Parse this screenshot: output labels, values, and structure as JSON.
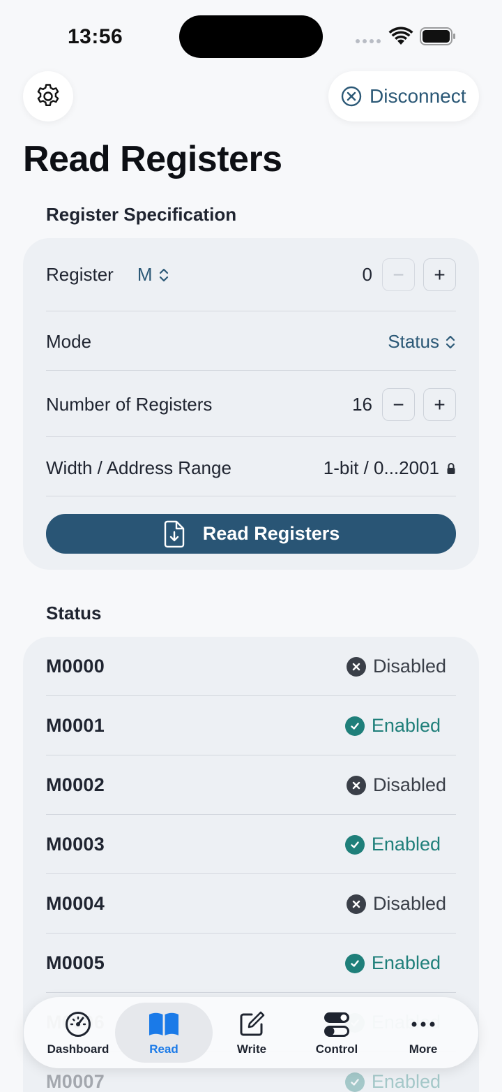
{
  "status_bar": {
    "time": "13:56"
  },
  "header": {
    "disconnect_label": "Disconnect",
    "title": "Read Registers"
  },
  "spec": {
    "section_title": "Register Specification",
    "register_label": "Register",
    "register_type": "M",
    "register_start": "0",
    "mode_label": "Mode",
    "mode_value": "Status",
    "count_label": "Number of Registers",
    "count_value": "16",
    "range_label": "Width / Address Range",
    "range_value": "1-bit / 0...2001",
    "read_button": "Read Registers",
    "minus": "−",
    "plus": "+"
  },
  "status": {
    "section_title": "Status",
    "rows": [
      {
        "name": "M0000",
        "state": "Disabled",
        "enabled": false
      },
      {
        "name": "M0001",
        "state": "Enabled",
        "enabled": true
      },
      {
        "name": "M0002",
        "state": "Disabled",
        "enabled": false
      },
      {
        "name": "M0003",
        "state": "Enabled",
        "enabled": true
      },
      {
        "name": "M0004",
        "state": "Disabled",
        "enabled": false
      },
      {
        "name": "M0005",
        "state": "Enabled",
        "enabled": true
      },
      {
        "name": "M0006",
        "state": "Enabled",
        "enabled": true
      },
      {
        "name": "M0007",
        "state": "Enabled",
        "enabled": true
      }
    ]
  },
  "colors": {
    "accent": "#2b5876",
    "enabled": "#1f7f7a",
    "disabled": "#3a3f48",
    "tab_active": "#1a7ae8"
  },
  "tabs": [
    {
      "label": "Dashboard",
      "icon": "gauge-icon",
      "active": false
    },
    {
      "label": "Read",
      "icon": "book-icon",
      "active": true
    },
    {
      "label": "Write",
      "icon": "edit-icon",
      "active": false
    },
    {
      "label": "Control",
      "icon": "toggles-icon",
      "active": false
    },
    {
      "label": "More",
      "icon": "ellipsis-icon",
      "active": false
    }
  ]
}
